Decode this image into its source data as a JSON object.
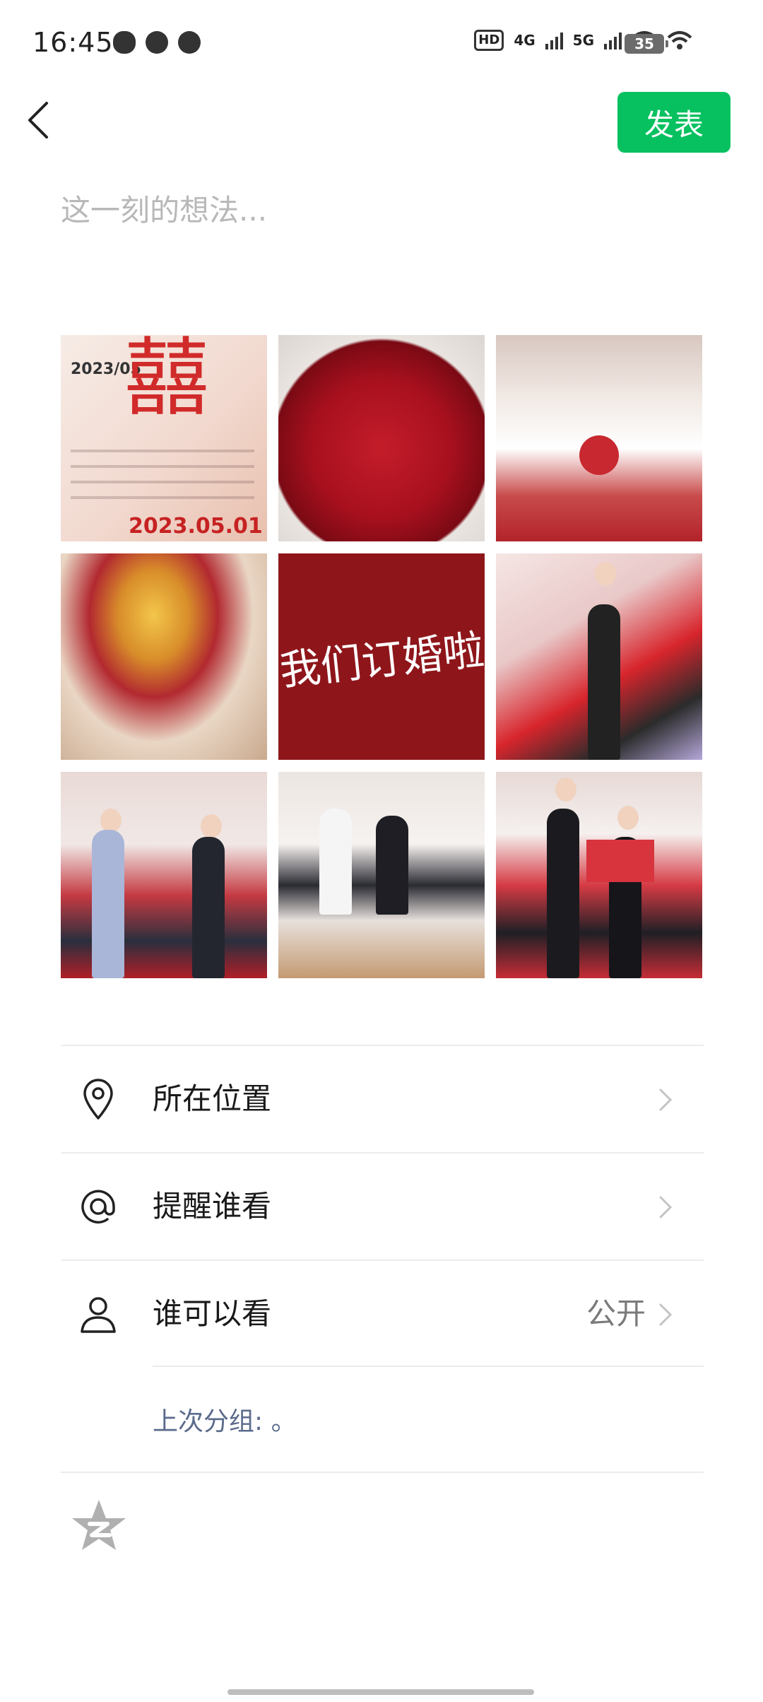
{
  "status_bar": {
    "time": "16:45",
    "left_icons": [
      "wechat-icon",
      "weibo-icon",
      "compass-app-icon"
    ],
    "hd_label": "HD",
    "network_4g": "4G",
    "network_5g": "5G",
    "battery": "35"
  },
  "header": {
    "back_icon": "chevron-left-icon",
    "publish_label": "发表"
  },
  "composer": {
    "placeholder": "这一刻的想法..."
  },
  "photos": [
    {
      "name": "engagement-calendar",
      "text_top": "2023/05",
      "text_main": "囍",
      "text_bottom": "2023.05.01"
    },
    {
      "name": "red-roses-bouquet"
    },
    {
      "name": "wedding-cake"
    },
    {
      "name": "fruit-heart-arrangement"
    },
    {
      "name": "engagement-announcement",
      "text": "我们订婚啦"
    },
    {
      "name": "signing-ceremony"
    },
    {
      "name": "gift-exchange"
    },
    {
      "name": "banquet-guests"
    },
    {
      "name": "couple-with-certificate"
    }
  ],
  "menu": {
    "location": {
      "label": "所在位置",
      "icon": "location-pin-icon"
    },
    "mention": {
      "label": "提醒谁看",
      "icon": "at-sign-icon"
    },
    "visibility": {
      "label": "谁可以看",
      "value": "公开",
      "icon": "person-icon"
    },
    "last_group": "上次分组: 。"
  },
  "footer": {
    "qzone_icon": "qzone-star-icon"
  },
  "colors": {
    "accent": "#07c160",
    "link": "#5b6b8c",
    "divider": "#ececec"
  }
}
